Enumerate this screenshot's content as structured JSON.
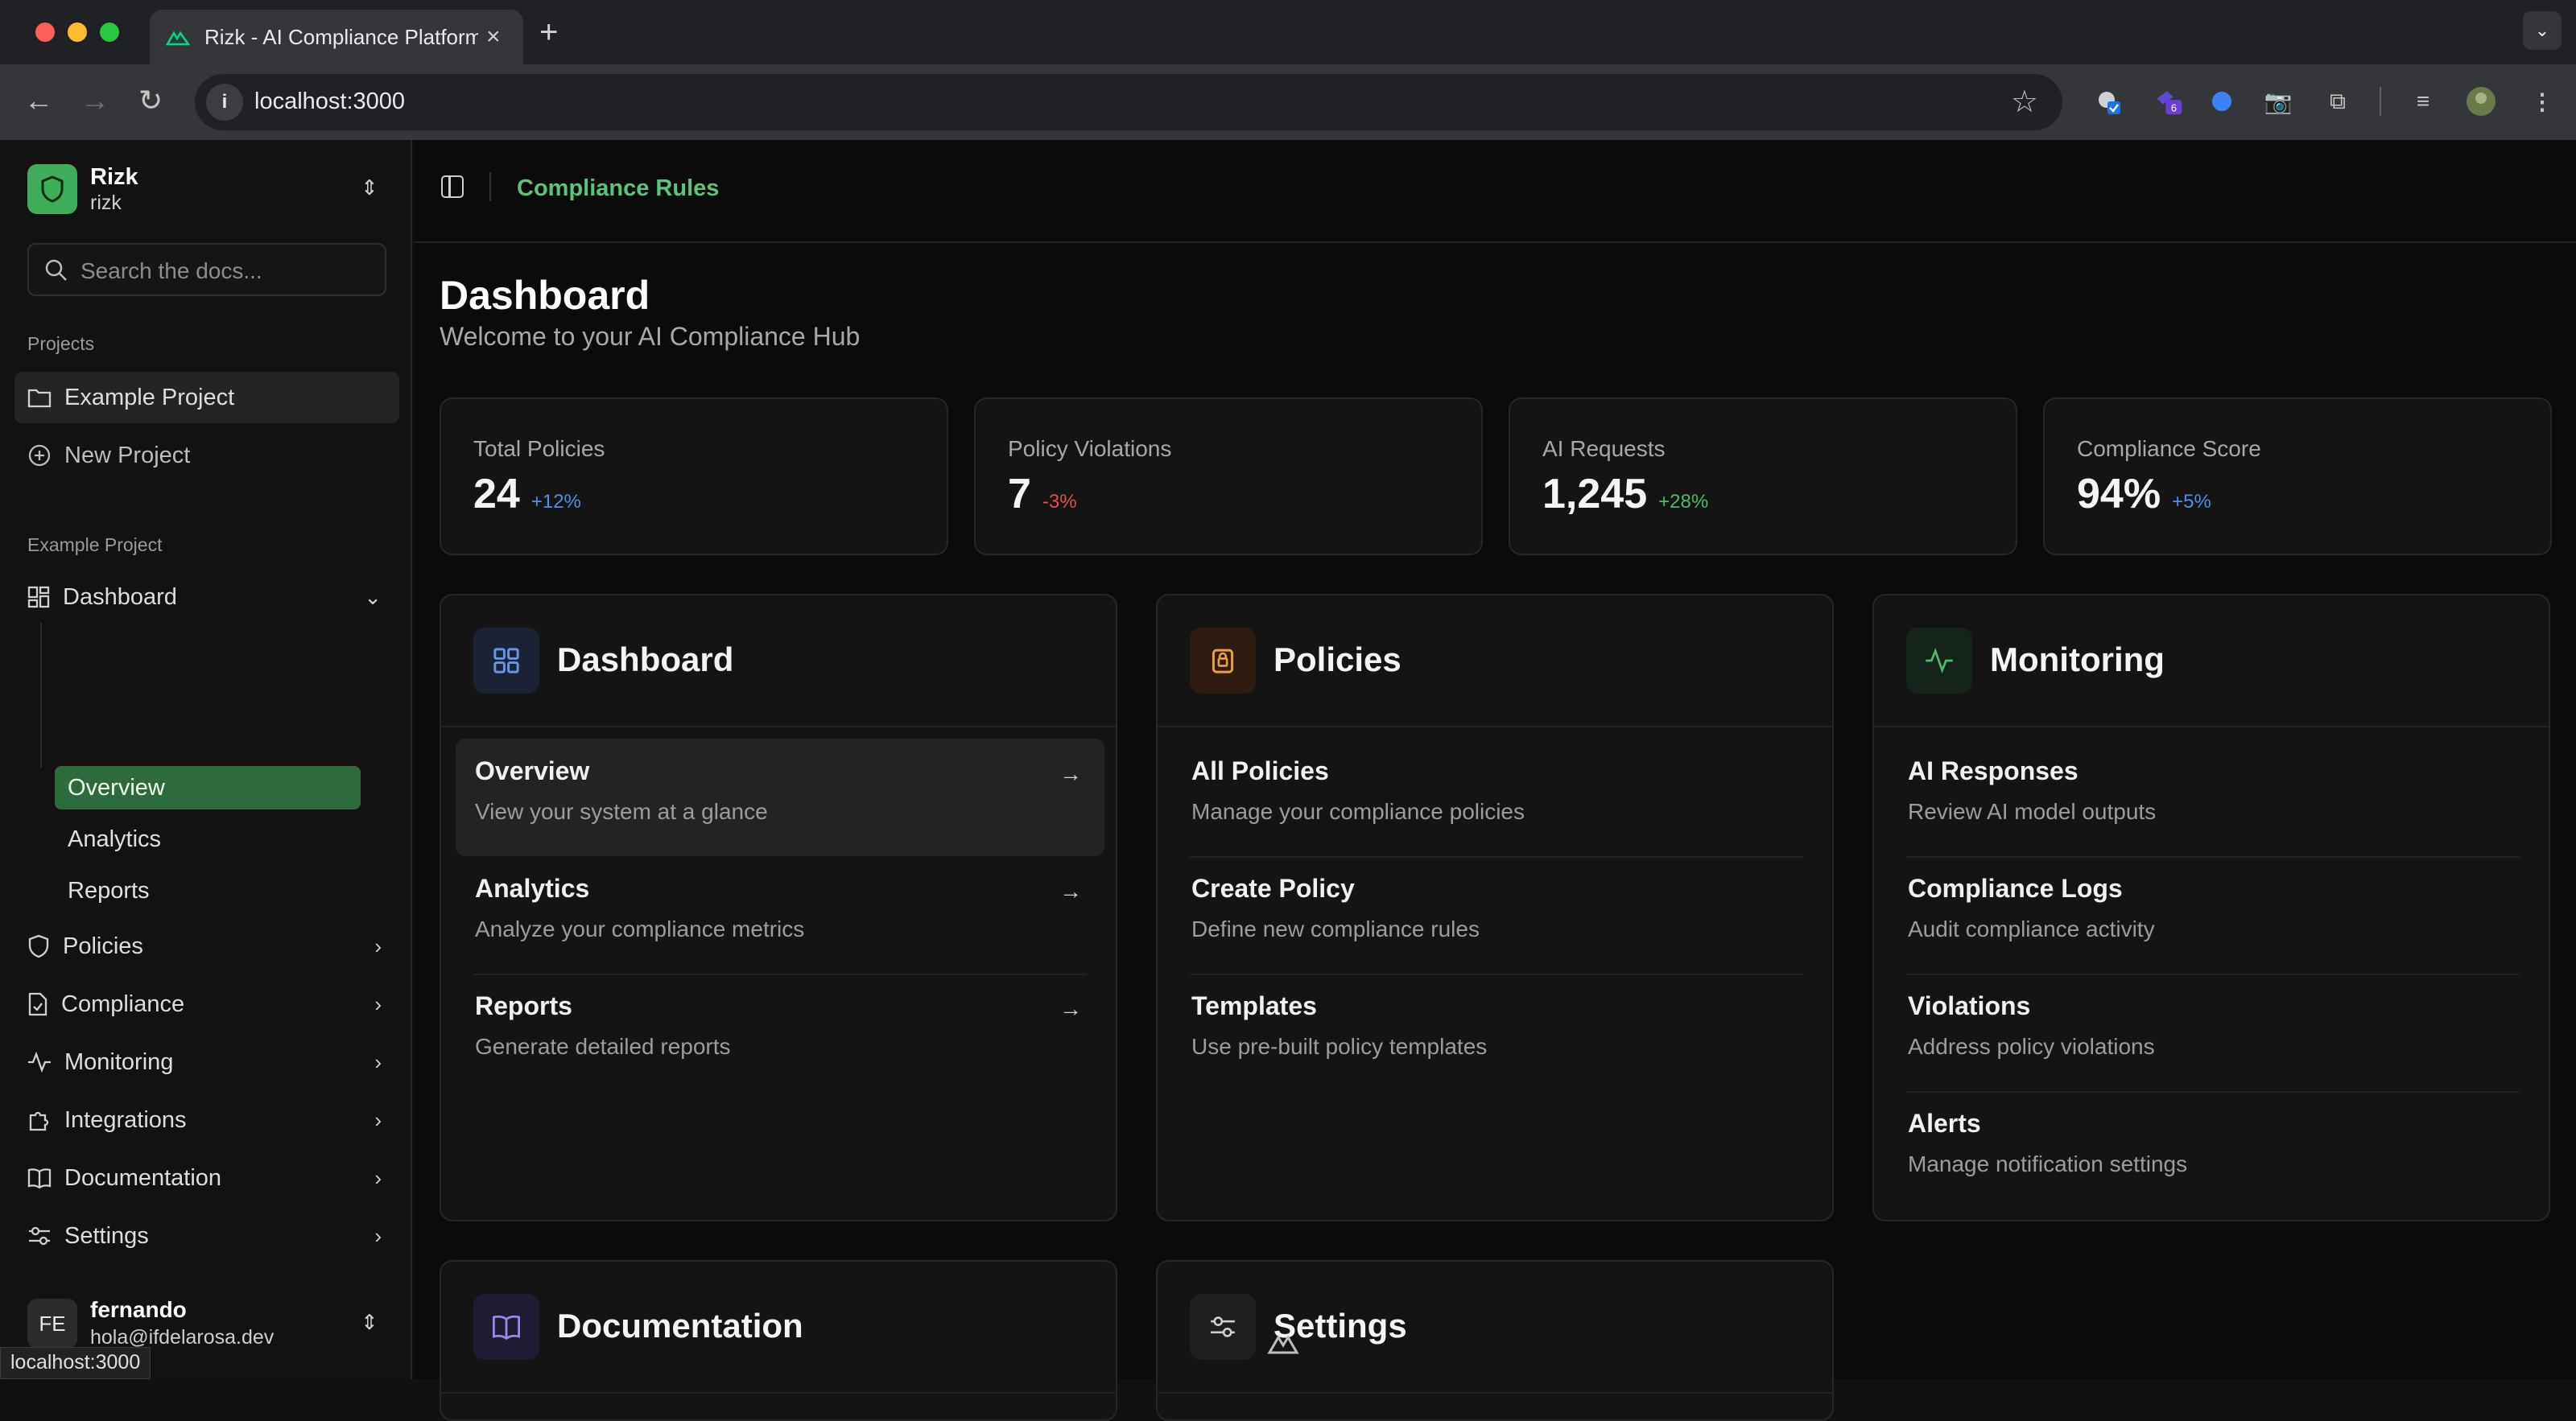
{
  "browser": {
    "tab_title": "Rizk - AI Compliance Platform",
    "url": "localhost:3000",
    "ext_badge": "6",
    "status_url": "localhost:3000"
  },
  "brand": {
    "name": "Rizk",
    "sub": "rizk"
  },
  "search": {
    "placeholder": "Search the docs..."
  },
  "projects": {
    "label": "Projects",
    "items": [
      "Example Project",
      "New Project"
    ]
  },
  "project_section": {
    "label": "Example Project"
  },
  "nav": {
    "dashboard": "Dashboard",
    "sub": [
      "Overview",
      "Analytics",
      "Reports"
    ],
    "items": [
      "Policies",
      "Compliance",
      "Monitoring",
      "Integrations",
      "Documentation",
      "Settings"
    ]
  },
  "user": {
    "initials": "FE",
    "name": "fernando",
    "email": "hola@ifdelarosa.dev"
  },
  "topbar": {
    "crumb": "Compliance Rules"
  },
  "page": {
    "title": "Dashboard",
    "subtitle": "Welcome to your AI Compliance Hub"
  },
  "stats": [
    {
      "label": "Total Policies",
      "value": "24",
      "change": "+12%",
      "color": "#4f8fe8"
    },
    {
      "label": "Policy Violations",
      "value": "7",
      "change": "-3%",
      "color": "#e05050"
    },
    {
      "label": "AI Requests",
      "value": "1,245",
      "change": "+28%",
      "color": "#4fb86a"
    },
    {
      "label": "Compliance Score",
      "value": "94%",
      "change": "+5%",
      "color": "#4f8fe8"
    }
  ],
  "cards": [
    {
      "title": "Dashboard",
      "icon": "grid-icon",
      "rows": [
        {
          "t": "Overview",
          "d": "View your system at a glance"
        },
        {
          "t": "Analytics",
          "d": "Analyze your compliance metrics"
        },
        {
          "t": "Reports",
          "d": "Generate detailed reports"
        }
      ]
    },
    {
      "title": "Policies",
      "icon": "lock-icon",
      "rows": [
        {
          "t": "All Policies",
          "d": "Manage your compliance policies"
        },
        {
          "t": "Create Policy",
          "d": "Define new compliance rules"
        },
        {
          "t": "Templates",
          "d": "Use pre-built policy templates"
        }
      ]
    },
    {
      "title": "Monitoring",
      "icon": "activity-icon",
      "rows": [
        {
          "t": "AI Responses",
          "d": "Review AI model outputs"
        },
        {
          "t": "Compliance Logs",
          "d": "Audit compliance activity"
        },
        {
          "t": "Violations",
          "d": "Address policy violations"
        },
        {
          "t": "Alerts",
          "d": "Manage notification settings"
        }
      ]
    },
    {
      "title": "Documentation",
      "icon": "book-icon",
      "rows": []
    },
    {
      "title": "Settings",
      "icon": "sliders-icon",
      "rows": []
    }
  ]
}
